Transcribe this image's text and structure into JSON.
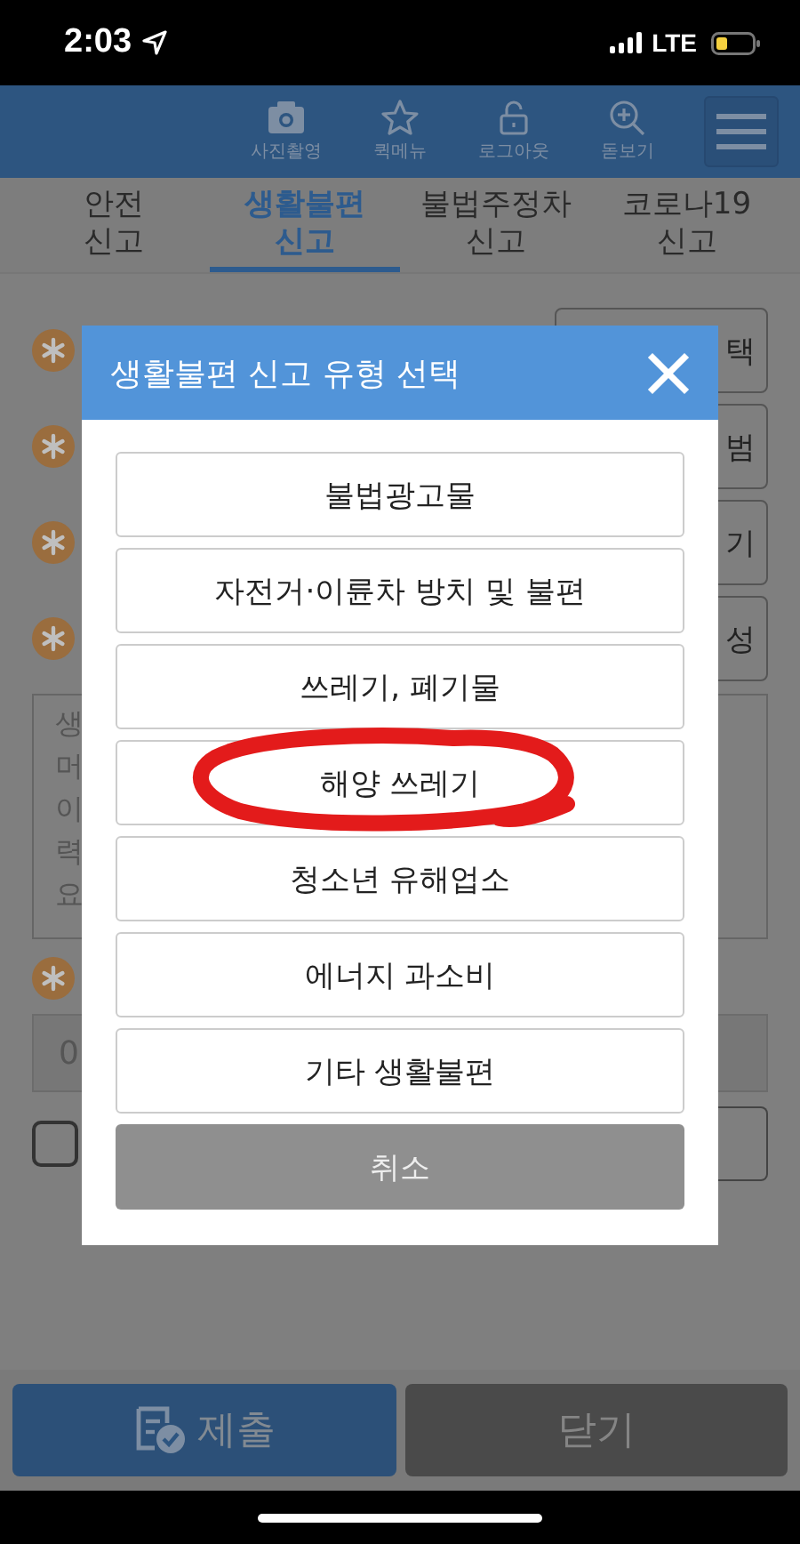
{
  "status_bar": {
    "time": "2:03",
    "network": "LTE"
  },
  "header": {
    "actions": [
      {
        "kind": "camera",
        "label": "사진촬영"
      },
      {
        "kind": "star",
        "label": "퀵메뉴"
      },
      {
        "kind": "lock",
        "label": "로그아웃"
      },
      {
        "kind": "zoom",
        "label": "돋보기"
      }
    ]
  },
  "tabs": [
    {
      "label": "안전\n신고",
      "selected": false
    },
    {
      "label": "생활불편\n신고",
      "selected": true
    },
    {
      "label": "불법주정차\n신고",
      "selected": false
    },
    {
      "label": "코로나19\n신고",
      "selected": false
    }
  ],
  "form": {
    "rows": [
      {
        "button_text": "택"
      },
      {
        "button_text": "범"
      },
      {
        "button_text": "기"
      },
      {
        "button_text": "성"
      }
    ],
    "textarea_lines": [
      "생",
      "머",
      "이",
      "력",
      "요"
    ],
    "field_value": "0",
    "checkbox_checked": false
  },
  "dialog": {
    "title": "생활불편 신고 유형 선택",
    "options": [
      {
        "label": "불법광고물",
        "circled": false
      },
      {
        "label": "자전거·이륜차 방치 및 불편",
        "circled": false
      },
      {
        "label": "쓰레기, 폐기물",
        "circled": false
      },
      {
        "label": "해양 쓰레기",
        "circled": true
      },
      {
        "label": "청소년 유해업소",
        "circled": false
      },
      {
        "label": "에너지 과소비",
        "circled": false
      },
      {
        "label": "기타 생활불편",
        "circled": false
      }
    ],
    "cancel": "취소"
  },
  "footer": {
    "submit": "제출",
    "close": "닫기"
  }
}
